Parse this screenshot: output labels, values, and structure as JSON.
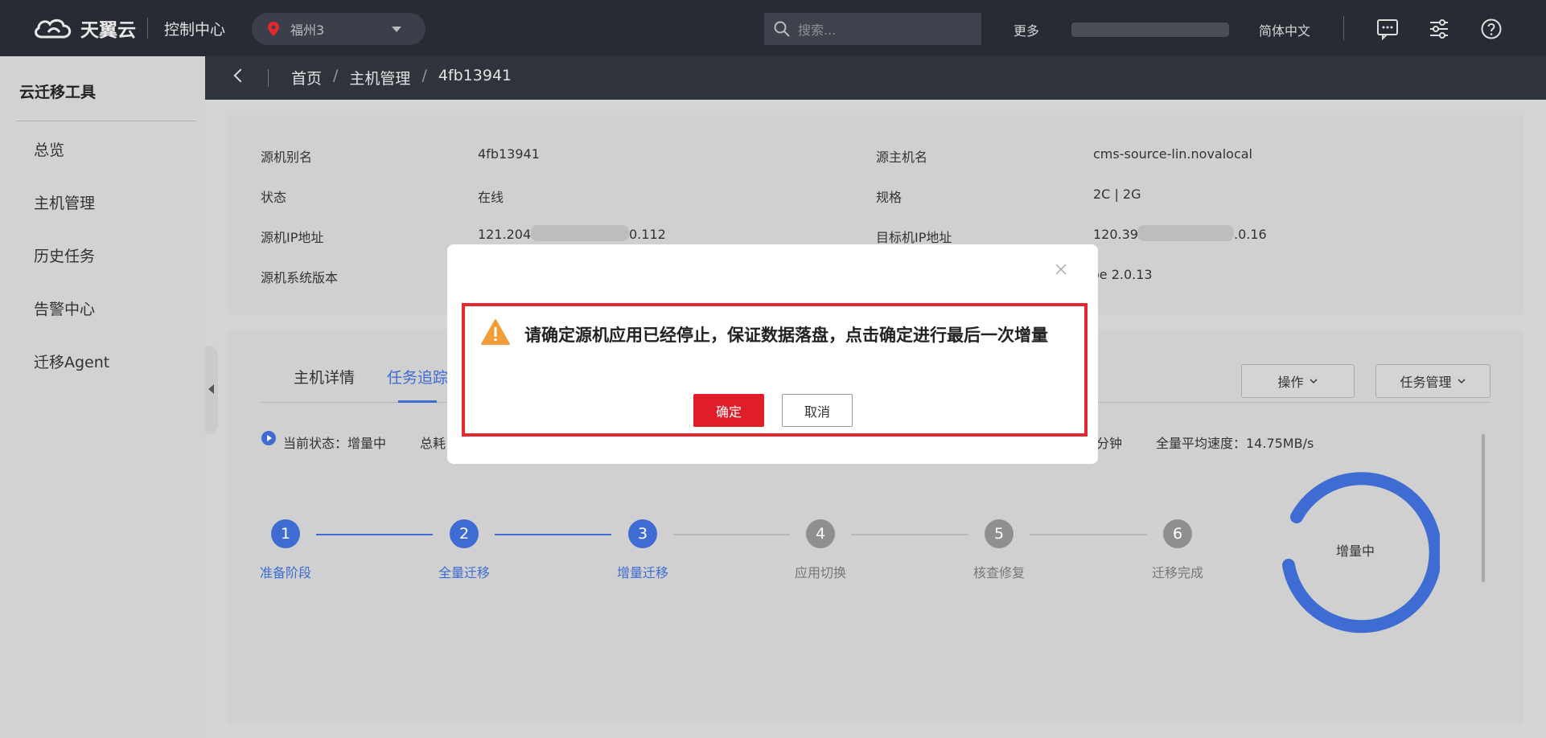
{
  "header": {
    "logo_text": "天翼云",
    "console_label": "控制中心",
    "region": "福州3",
    "search_placeholder": "搜索...",
    "more_label": "更多",
    "language": "简体中文"
  },
  "sidebar": {
    "title": "云迁移工具",
    "items": [
      {
        "label": "总览"
      },
      {
        "label": "主机管理"
      },
      {
        "label": "历史任务"
      },
      {
        "label": "告警中心"
      },
      {
        "label": "迁移Agent"
      }
    ]
  },
  "breadcrumb": {
    "home": "首页",
    "section": "主机管理",
    "current": "4fb13941",
    "separator": "/"
  },
  "info": {
    "alias_label": "源机别名",
    "alias_value": "4fb13941",
    "status_label": "状态",
    "status_value": "在线",
    "source_ip_label": "源机IP地址",
    "source_ip_prefix": "121.204.",
    "source_ip_suffix": "0.112",
    "os_label": "源机系统版本",
    "hostname_label": "源主机名",
    "hostname_value": "cms-source-lin.novalocal",
    "spec_label": "规格",
    "spec_value": "2C | 2G",
    "target_ip_label": "目标机IP地址",
    "target_ip_prefix": "120.39.",
    "target_ip_suffix": ".0.16",
    "agent_version_partial": "oe 2.0.13"
  },
  "task": {
    "tabs": [
      {
        "label": "主机详情"
      },
      {
        "label": "任务追踪"
      }
    ],
    "actions_label": "操作",
    "task_mgmt_label": "任务管理",
    "status_label": "当前状态：增量中",
    "total_prefix": "总耗",
    "minutes_partial": "分钟",
    "avg_speed_label": "全量平均速度：14.75MB/s",
    "steps": [
      {
        "num": "1",
        "label": "准备阶段",
        "state": "done"
      },
      {
        "num": "2",
        "label": "全量迁移",
        "state": "done"
      },
      {
        "num": "3",
        "label": "增量迁移",
        "state": "active"
      },
      {
        "num": "4",
        "label": "应用切换",
        "state": "pending"
      },
      {
        "num": "5",
        "label": "核查修复",
        "state": "pending"
      },
      {
        "num": "6",
        "label": "迁移完成",
        "state": "pending"
      }
    ],
    "ring_label": "增量中"
  },
  "dialog": {
    "message": "请确定源机应用已经停止，保证数据落盘，点击确定进行最后一次增量",
    "confirm_label": "确定",
    "cancel_label": "取消"
  },
  "colors": {
    "accent_blue": "#3e6cd3",
    "danger_red": "#df1e2a",
    "warning_orange": "#f29d38"
  }
}
